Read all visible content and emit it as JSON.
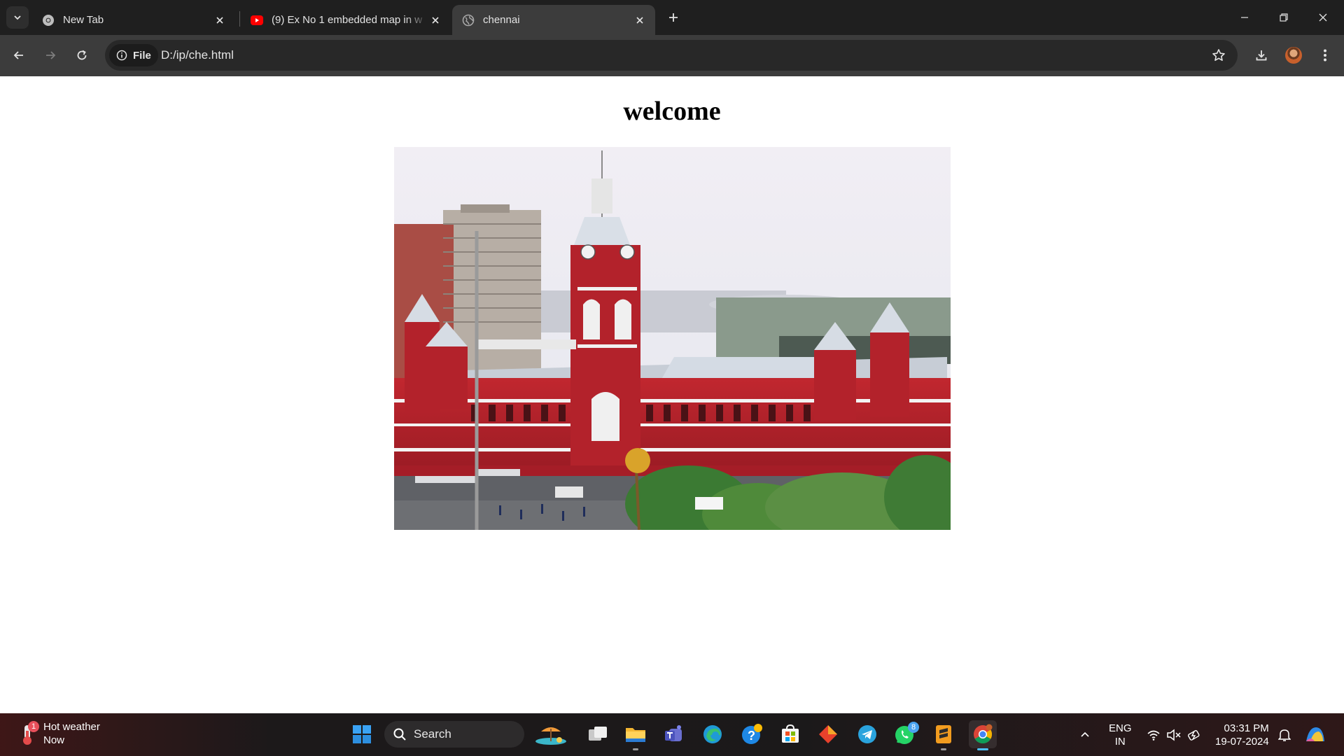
{
  "browser": {
    "tabs": [
      {
        "title": "New Tab",
        "favicon": "chrome-icon",
        "active": false
      },
      {
        "title": "(9) Ex No 1 embedded map in w",
        "favicon": "youtube-icon",
        "active": false
      },
      {
        "title": "chennai",
        "favicon": "globe-icon",
        "active": true
      }
    ],
    "address": {
      "scheme_chip": "File",
      "url": "D:/ip/che.html"
    }
  },
  "page": {
    "heading": "welcome",
    "image_alt": "Chennai Central railway station"
  },
  "taskbar": {
    "weather": {
      "title": "Hot weather",
      "subtitle": "Now",
      "badge": "1"
    },
    "search_label": "Search",
    "apps": [
      "start-icon",
      "search",
      "travel-app-icon",
      "task-view-icon",
      "file-explorer-icon",
      "teams-icon",
      "edge-icon",
      "help-icon",
      "ms-store-icon",
      "office-app-icon",
      "telegram-icon",
      "whatsapp-icon",
      "sublime-text-icon",
      "chrome-icon"
    ],
    "whatsapp_badge": "8",
    "tray": {
      "lang_line1": "ENG",
      "lang_line2": "IN",
      "time": "03:31 PM",
      "date": "19-07-2024"
    }
  },
  "colors": {
    "tabstrip": "#1f1f1f",
    "toolbar": "#3c3c3c",
    "omnibox": "#282828",
    "taskbar": "#1c1a1b",
    "station_red": "#b5222c"
  }
}
